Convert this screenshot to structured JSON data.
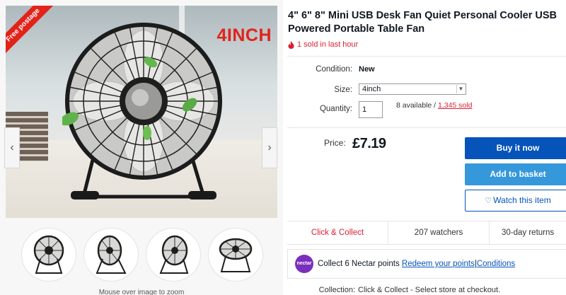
{
  "gallery": {
    "ribbon_text": "Free postage",
    "overlay_text": "4INCH",
    "prev_arrow": "‹",
    "next_arrow": "›",
    "thumbnails": [
      {
        "icon": "fan-front-icon"
      },
      {
        "icon": "fan-side-icon"
      },
      {
        "icon": "fan-angle-icon"
      },
      {
        "icon": "fan-top-icon"
      }
    ],
    "caption": "Mouse over image to zoom"
  },
  "listing": {
    "title": "4\" 6\" 8\" Mini USB Desk Fan Quiet Personal Cooler USB Powered Portable Table Fan",
    "sold_recent": "1 sold in last hour",
    "condition_label": "Condition:",
    "condition_value": "New",
    "size_label": "Size:",
    "size_value": "4inch",
    "quantity_label": "Quantity:",
    "quantity_value": "1",
    "available_text": "8 available / ",
    "sold_link": "1,345 sold",
    "price_label": "Price:",
    "price_value": "£7.19"
  },
  "actions": {
    "buy_now": "Buy it now",
    "add_to_basket": "Add to basket",
    "watch": "Watch this item"
  },
  "info_bar": {
    "click_collect": "Click & Collect",
    "watchers": "207 watchers",
    "returns": "30-day returns"
  },
  "nectar": {
    "logo_text": "nectar",
    "points_text": "Collect 6 Nectar points ",
    "redeem_link": "Redeem your points",
    "separator": " | ",
    "conditions_link": "Conditions"
  },
  "collection": {
    "label": "Collection:",
    "value": "Click & Collect - Select store at checkout."
  },
  "colors": {
    "brand_blue": "#0654ba",
    "basket_blue": "#3498db",
    "alert_red": "#dd1e31",
    "nectar_purple": "#7b2fbf"
  }
}
